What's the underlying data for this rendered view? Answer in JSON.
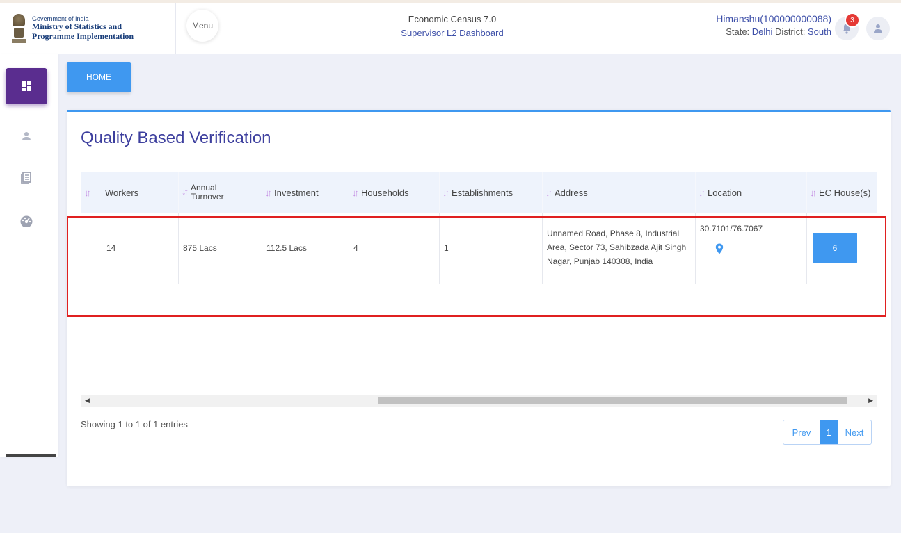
{
  "header": {
    "gov": "Government of India",
    "ministry_line1": "Ministry of Statistics and",
    "ministry_line2": "Programme Implementation",
    "menu_label": "Menu",
    "title": "Economic Census 7.0",
    "subtitle": "Supervisor L2 Dashboard",
    "username": "Himanshu(100000000088)",
    "state_label": "State:",
    "state": "Delhi",
    "district_label": "District:",
    "district": "South",
    "notification_count": "3"
  },
  "sidebar": {
    "items": [
      {
        "icon": "dashboard-icon",
        "active": true
      },
      {
        "icon": "user-icon",
        "active": false
      },
      {
        "icon": "document-icon",
        "active": false
      },
      {
        "icon": "gauge-icon",
        "active": false
      }
    ]
  },
  "home_button": "HOME",
  "card": {
    "title": "Quality Based Verification",
    "columns": [
      "Workers",
      "Annual Turnover",
      "Investment",
      "Households",
      "Establishments",
      "Address",
      "Location",
      "EC House(s)"
    ],
    "rows": [
      {
        "workers": "14",
        "turnover": "875 Lacs",
        "investment": "112.5 Lacs",
        "households": "4",
        "establishments": "1",
        "address": "Unnamed Road, Phase 8, Industrial Area, Sector 73, Sahibzada Ajit Singh Nagar, Punjab 140308, India",
        "location": "30.7101/76.7067",
        "ec_houses": "6"
      }
    ],
    "entries_text": "Showing 1 to 1 of 1 entries",
    "pagination": {
      "prev": "Prev",
      "current": "1",
      "next": "Next"
    }
  },
  "colors": {
    "accent": "#3f98f0",
    "sidebar_active": "#5a2d8f",
    "title": "#3d3f9e",
    "highlight_box": "#e02020"
  }
}
